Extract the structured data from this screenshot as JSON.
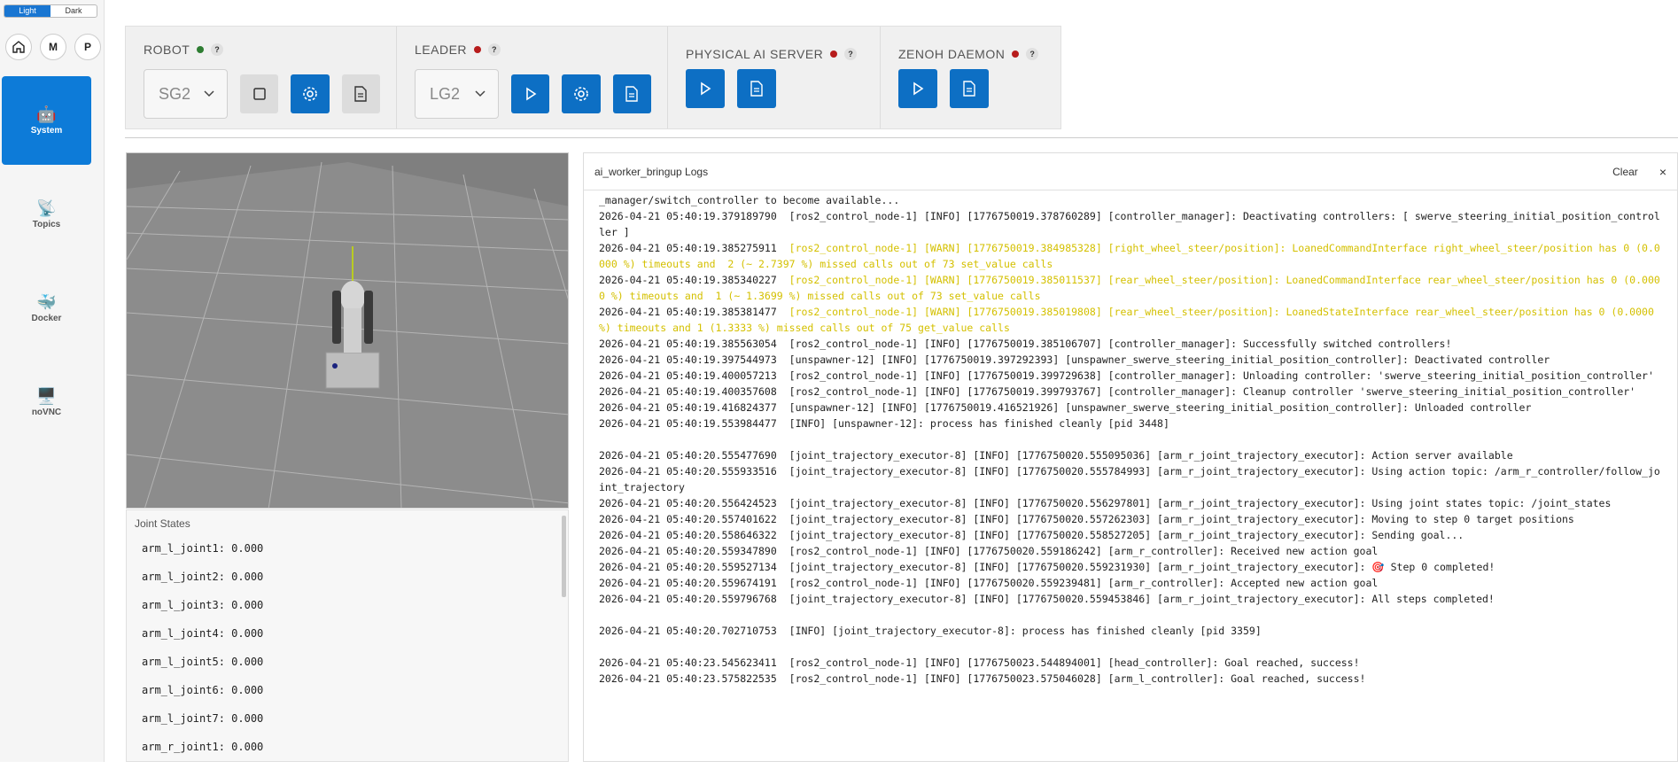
{
  "theme": {
    "light": "Light",
    "dark": "Dark"
  },
  "round_buttons": [
    "M",
    "P"
  ],
  "nav": [
    {
      "label": "System",
      "icon": "🤖"
    },
    {
      "label": "Topics",
      "icon": "📡"
    },
    {
      "label": "Docker",
      "icon": "🐳"
    },
    {
      "label": "noVNC",
      "icon": "🖥️"
    }
  ],
  "controls": {
    "robot": {
      "title": "ROBOT",
      "status": "green",
      "select": "SG2"
    },
    "leader": {
      "title": "LEADER",
      "status": "red",
      "select": "LG2"
    },
    "server": {
      "title": "PHYSICAL AI SERVER",
      "status": "red"
    },
    "zenoh": {
      "title": "ZENOH DAEMON",
      "status": "red"
    },
    "help": "?"
  },
  "joints": {
    "title": "Joint States",
    "items": [
      "arm_l_joint1: 0.000",
      "arm_l_joint2: 0.000",
      "arm_l_joint3: 0.000",
      "arm_l_joint4: 0.000",
      "arm_l_joint5: 0.000",
      "arm_l_joint6: 0.000",
      "arm_l_joint7: 0.000",
      "arm_r_joint1: 0.000"
    ]
  },
  "logs": {
    "title": "ai_worker_bringup Logs",
    "clear": "Clear",
    "close": "×",
    "lines": [
      {
        "ts": "",
        "text": "_manager/switch_controller to become available...",
        "warn": false
      },
      {
        "ts": "2026-04-21 05:40:19.379189790",
        "text": "[ros2_control_node-1] [INFO] [1776750019.378760289] [controller_manager]: Deactivating controllers: [ swerve_steering_initial_position_controller ]",
        "warn": false
      },
      {
        "ts": "2026-04-21 05:40:19.385275911",
        "text": "[ros2_control_node-1] [WARN] [1776750019.384985328] [right_wheel_steer/position]: LoanedCommandInterface right_wheel_steer/position has 0 (0.0000 %) timeouts and  2 (~ 2.7397 %) missed calls out of 73 set_value calls",
        "warn": true
      },
      {
        "ts": "2026-04-21 05:40:19.385340227",
        "text": "[ros2_control_node-1] [WARN] [1776750019.385011537] [rear_wheel_steer/position]: LoanedCommandInterface rear_wheel_steer/position has 0 (0.0000 %) timeouts and  1 (~ 1.3699 %) missed calls out of 73 set_value calls",
        "warn": true
      },
      {
        "ts": "2026-04-21 05:40:19.385381477",
        "text": "[ros2_control_node-1] [WARN] [1776750019.385019808] [rear_wheel_steer/position]: LoanedStateInterface rear_wheel_steer/position has 0 (0.0000 %) timeouts and 1 (1.3333 %) missed calls out of 75 get_value calls",
        "warn": true
      },
      {
        "ts": "2026-04-21 05:40:19.385563054",
        "text": "[ros2_control_node-1] [INFO] [1776750019.385106707] [controller_manager]: Successfully switched controllers!",
        "warn": false
      },
      {
        "ts": "2026-04-21 05:40:19.397544973",
        "text": "[unspawner-12] [INFO] [1776750019.397292393] [unspawner_swerve_steering_initial_position_controller]: Deactivated controller",
        "warn": false
      },
      {
        "ts": "2026-04-21 05:40:19.400057213",
        "text": "[ros2_control_node-1] [INFO] [1776750019.399729638] [controller_manager]: Unloading controller: 'swerve_steering_initial_position_controller'",
        "warn": false
      },
      {
        "ts": "2026-04-21 05:40:19.400357608",
        "text": "[ros2_control_node-1] [INFO] [1776750019.399793767] [controller_manager]: Cleanup controller 'swerve_steering_initial_position_controller'",
        "warn": false
      },
      {
        "ts": "2026-04-21 05:40:19.416824377",
        "text": "[unspawner-12] [INFO] [1776750019.416521926] [unspawner_swerve_steering_initial_position_controller]: Unloaded controller",
        "warn": false
      },
      {
        "ts": "2026-04-21 05:40:19.553984477",
        "text": "[INFO] [unspawner-12]: process has finished cleanly [pid 3448]",
        "warn": false
      },
      {
        "ts": "",
        "text": " ",
        "warn": false
      },
      {
        "ts": "2026-04-21 05:40:20.555477690",
        "text": "[joint_trajectory_executor-8] [INFO] [1776750020.555095036] [arm_r_joint_trajectory_executor]: Action server available",
        "warn": false
      },
      {
        "ts": "2026-04-21 05:40:20.555933516",
        "text": "[joint_trajectory_executor-8] [INFO] [1776750020.555784993] [arm_r_joint_trajectory_executor]: Using action topic: /arm_r_controller/follow_joint_trajectory",
        "warn": false
      },
      {
        "ts": "2026-04-21 05:40:20.556424523",
        "text": "[joint_trajectory_executor-8] [INFO] [1776750020.556297801] [arm_r_joint_trajectory_executor]: Using joint states topic: /joint_states",
        "warn": false
      },
      {
        "ts": "2026-04-21 05:40:20.557401622",
        "text": "[joint_trajectory_executor-8] [INFO] [1776750020.557262303] [arm_r_joint_trajectory_executor]: Moving to step 0 target positions",
        "warn": false
      },
      {
        "ts": "2026-04-21 05:40:20.558646322",
        "text": "[joint_trajectory_executor-8] [INFO] [1776750020.558527205] [arm_r_joint_trajectory_executor]: Sending goal...",
        "warn": false
      },
      {
        "ts": "2026-04-21 05:40:20.559347890",
        "text": "[ros2_control_node-1] [INFO] [1776750020.559186242] [arm_r_controller]: Received new action goal",
        "warn": false
      },
      {
        "ts": "2026-04-21 05:40:20.559527134",
        "text": "[joint_trajectory_executor-8] [INFO] [1776750020.559231930] [arm_r_joint_trajectory_executor]: 🎯 Step 0 completed!",
        "warn": false
      },
      {
        "ts": "2026-04-21 05:40:20.559674191",
        "text": "[ros2_control_node-1] [INFO] [1776750020.559239481] [arm_r_controller]: Accepted new action goal",
        "warn": false
      },
      {
        "ts": "2026-04-21 05:40:20.559796768",
        "text": "[joint_trajectory_executor-8] [INFO] [1776750020.559453846] [arm_r_joint_trajectory_executor]: All steps completed!",
        "warn": false
      },
      {
        "ts": "",
        "text": " ",
        "warn": false
      },
      {
        "ts": "2026-04-21 05:40:20.702710753",
        "text": "[INFO] [joint_trajectory_executor-8]: process has finished cleanly [pid 3359]",
        "warn": false
      },
      {
        "ts": "",
        "text": " ",
        "warn": false
      },
      {
        "ts": "2026-04-21 05:40:23.545623411",
        "text": "[ros2_control_node-1] [INFO] [1776750023.544894001] [head_controller]: Goal reached, success!",
        "warn": false
      },
      {
        "ts": "2026-04-21 05:40:23.575822535",
        "text": "[ros2_control_node-1] [INFO] [1776750023.575046028] [arm_l_controller]: Goal reached, success!",
        "warn": false
      }
    ]
  }
}
